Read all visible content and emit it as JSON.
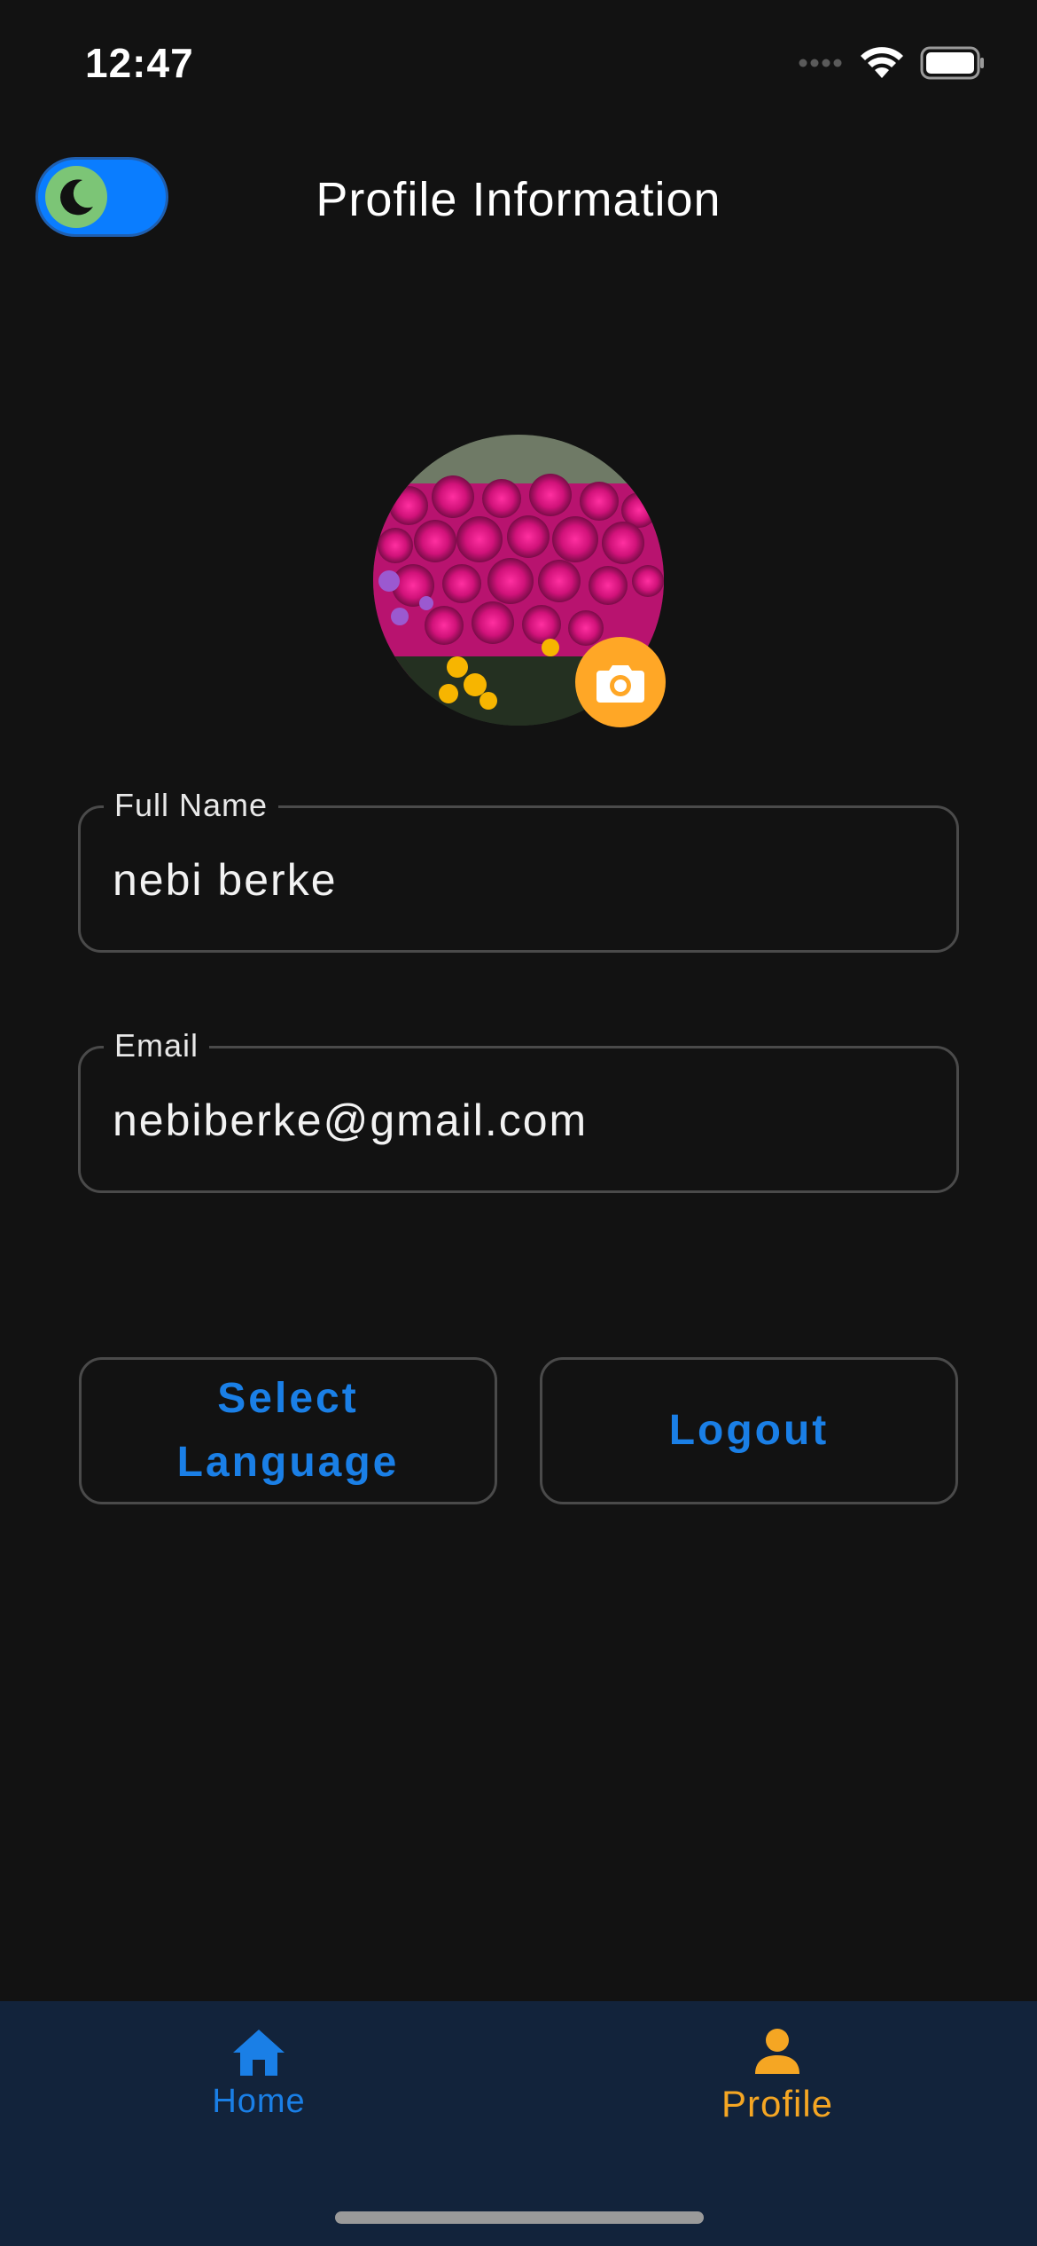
{
  "status_bar": {
    "time": "12:47",
    "icons": [
      "signal-dots-icon",
      "wifi-icon",
      "battery-icon"
    ]
  },
  "header": {
    "title": "Profile Information",
    "theme_toggle": {
      "state": "dark",
      "icon": "moon-icon",
      "on": true
    }
  },
  "avatar": {
    "image": "pink-flowers-photo",
    "camera_icon": "camera-icon"
  },
  "form": {
    "full_name": {
      "label": "Full Name",
      "value": "nebi berke"
    },
    "email": {
      "label": "Email",
      "value": "nebiberke@gmail.com"
    }
  },
  "actions": {
    "select_language_line1": "Select",
    "select_language_line2": "Language",
    "logout": "Logout"
  },
  "bottom_nav": {
    "items": [
      {
        "label": "Home",
        "icon": "home-icon",
        "active": false
      },
      {
        "label": "Profile",
        "icon": "person-icon",
        "active": true
      }
    ]
  },
  "colors": {
    "background": "#121212",
    "accent_blue": "#1a7fe6",
    "accent_orange": "#ffa726",
    "nav_background": "#12233b",
    "border": "#4a4a4a"
  }
}
